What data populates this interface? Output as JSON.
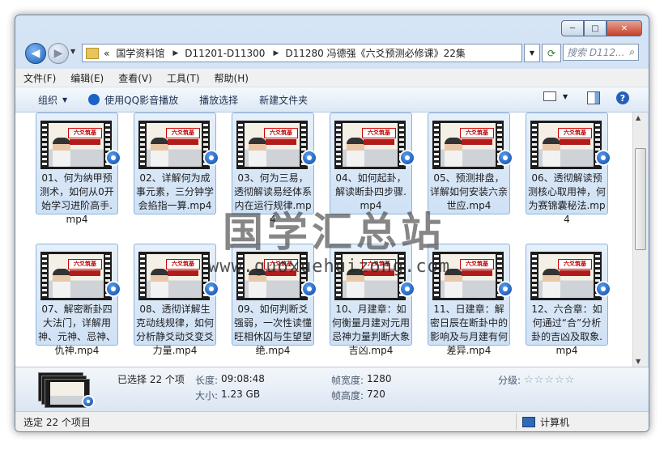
{
  "window": {
    "min": "─",
    "max": "□",
    "close": "✕"
  },
  "nav": {
    "back": "◀",
    "forward": "▶",
    "breadcrumbs": [
      "国学资料馆",
      "D11201-D11300",
      "D11280 冯德强《六爻预测必修课》22集"
    ],
    "search_placeholder": "搜索 D112..."
  },
  "menu": [
    "文件(F)",
    "编辑(E)",
    "查看(V)",
    "工具(T)",
    "帮助(H)"
  ],
  "toolbar": {
    "organize": "组织",
    "play_qq": "使用QQ影音播放",
    "play_selection": "播放选择",
    "new_folder": "新建文件夹"
  },
  "thumb_text": {
    "banner": "六爻筑基"
  },
  "files": [
    "01、何为纳甲预测术，如何从0开始学习进阶高手.mp4",
    "02、详解何为成事元素，三分钟学会掐指一算.mp4",
    "03、何为三易，透彻解读易经体系内在运行规律.mp4",
    "04、如何起卦，解读断卦四步骤.mp4",
    "05、预测排盘，详解如何安装六亲世应.mp4",
    "06、透彻解读预测核心取用神，何为赛锦囊秘法.mp4",
    "07、解密断卦四大法门，详解用神、元神、忌神、仇神.mp4",
    "08、透彻详解生克动线规律，如何分析静爻动爻变爻力量.mp4",
    "09、如何判断爻强弱，一次性读懂旺相休囚与生望望绝.mp4",
    "10、月建章：如何衡量月建对元用忌神力量判断大象吉凶.mp4",
    "11、日建章：解密日辰在断卦中的影响及与月建有何差异.mp4",
    "12、六合章：如何通过“合”分析卦的吉凶及取象.mp4"
  ],
  "watermark": {
    "title": "国学汇总站",
    "url": "www.guoxuehuizong.com"
  },
  "details": {
    "selected": "已选择 22 个项",
    "length_label": "长度:",
    "length_value": "09:08:48",
    "size_label": "大小:",
    "size_value": "1.23 GB",
    "width_label": "帧宽度:",
    "width_value": "1280",
    "height_label": "帧高度:",
    "height_value": "720",
    "rating_label": "分级:",
    "rating_stars": "☆☆☆☆☆"
  },
  "status": {
    "left": "选定 22 个项目",
    "right": "计算机"
  }
}
